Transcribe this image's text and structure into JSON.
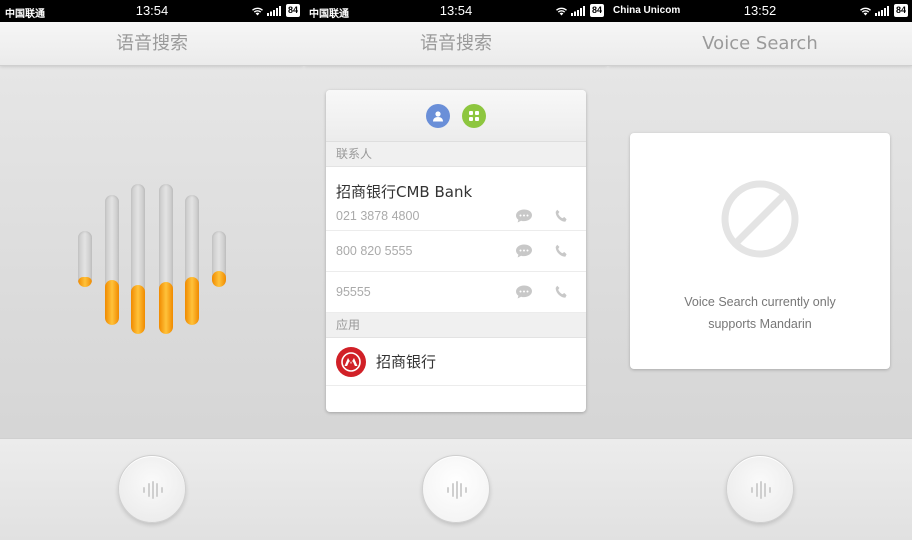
{
  "screens": [
    {
      "status": {
        "carrier": "中国联通",
        "time": "13:54",
        "battery": "84"
      },
      "title": "语音搜索",
      "level_meter": {
        "bar_levels": [
          0.18,
          0.35,
          0.33,
          0.35,
          0.37,
          0.28
        ]
      }
    },
    {
      "status": {
        "carrier": "中国联通",
        "time": "13:54",
        "battery": "84"
      },
      "title": "语音搜索",
      "results": {
        "category_icons": [
          "contacts-icon",
          "apps-icon"
        ],
        "contacts_header": "联系人",
        "contact_name": "招商银行CMB Bank",
        "numbers": [
          "021 3878 4800",
          "800 820 5555",
          "95555"
        ],
        "apps_header": "应用",
        "app_name": "招商银行"
      }
    },
    {
      "status": {
        "carrier": "China Unicom",
        "time": "13:52",
        "battery": "84"
      },
      "title": "Voice Search",
      "notice": {
        "icon": "prohibited-icon",
        "line1": "Voice Search currently only",
        "line2": "supports Mandarin"
      }
    }
  ],
  "colors": {
    "accent": "#F7941D",
    "contacts": "#6A8FD8",
    "apps": "#8DC63F",
    "bank": "#D12027"
  }
}
